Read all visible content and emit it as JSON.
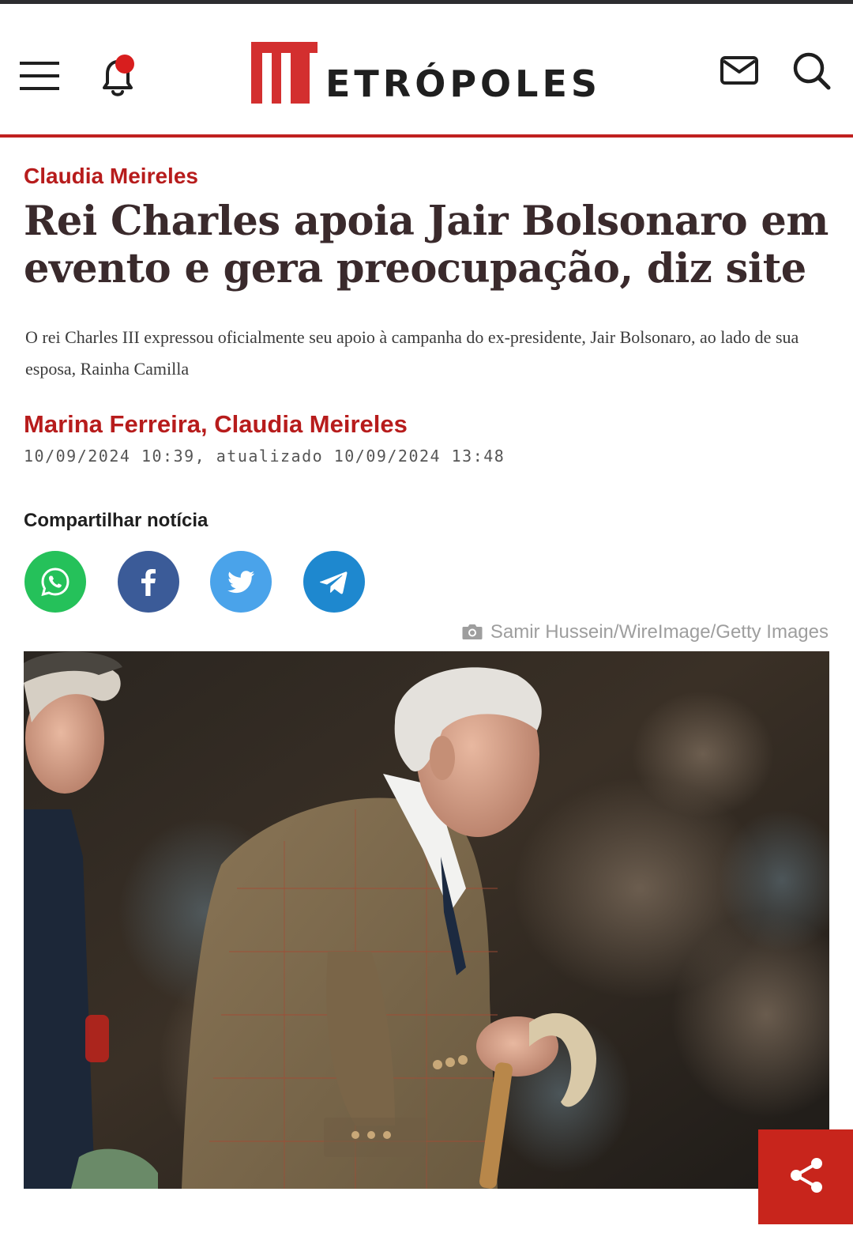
{
  "header": {
    "logo_initial": "M",
    "logo_rest": "ETRÓPOLES",
    "notification_badge": true,
    "icons": [
      "menu-icon",
      "bell-icon",
      "mail-icon",
      "search-icon"
    ],
    "brand_color": "#c0201f"
  },
  "article": {
    "section": "Claudia Meireles",
    "headline": "Rei Charles apoia Jair Bolsonaro em evento e gera preocupação, diz site",
    "lead": "O rei Charles III expressou oficialmente seu apoio à campanha do ex-presidente, Jair Bolsonaro, ao lado de sua esposa, Rainha Camilla",
    "authors": "Marina Ferreira, Claudia Meireles",
    "dateline": "10/09/2024 10:39, atualizado 10/09/2024 13:48"
  },
  "share": {
    "title": "Compartilhar notícia",
    "buttons": [
      {
        "name": "whatsapp",
        "icon": "whatsapp-icon",
        "color": "#25c15a"
      },
      {
        "name": "facebook",
        "icon": "facebook-icon",
        "color": "#3b5b98"
      },
      {
        "name": "twitter",
        "icon": "twitter-icon",
        "color": "#4aa3ea"
      },
      {
        "name": "telegram",
        "icon": "telegram-icon",
        "color": "#1e88cf"
      }
    ]
  },
  "photo": {
    "credit": "Samir Hussein/WireImage/Getty Images",
    "credit_icon": "camera-icon"
  },
  "floating_share": {
    "icon": "share-icon",
    "color": "#c8251c"
  }
}
